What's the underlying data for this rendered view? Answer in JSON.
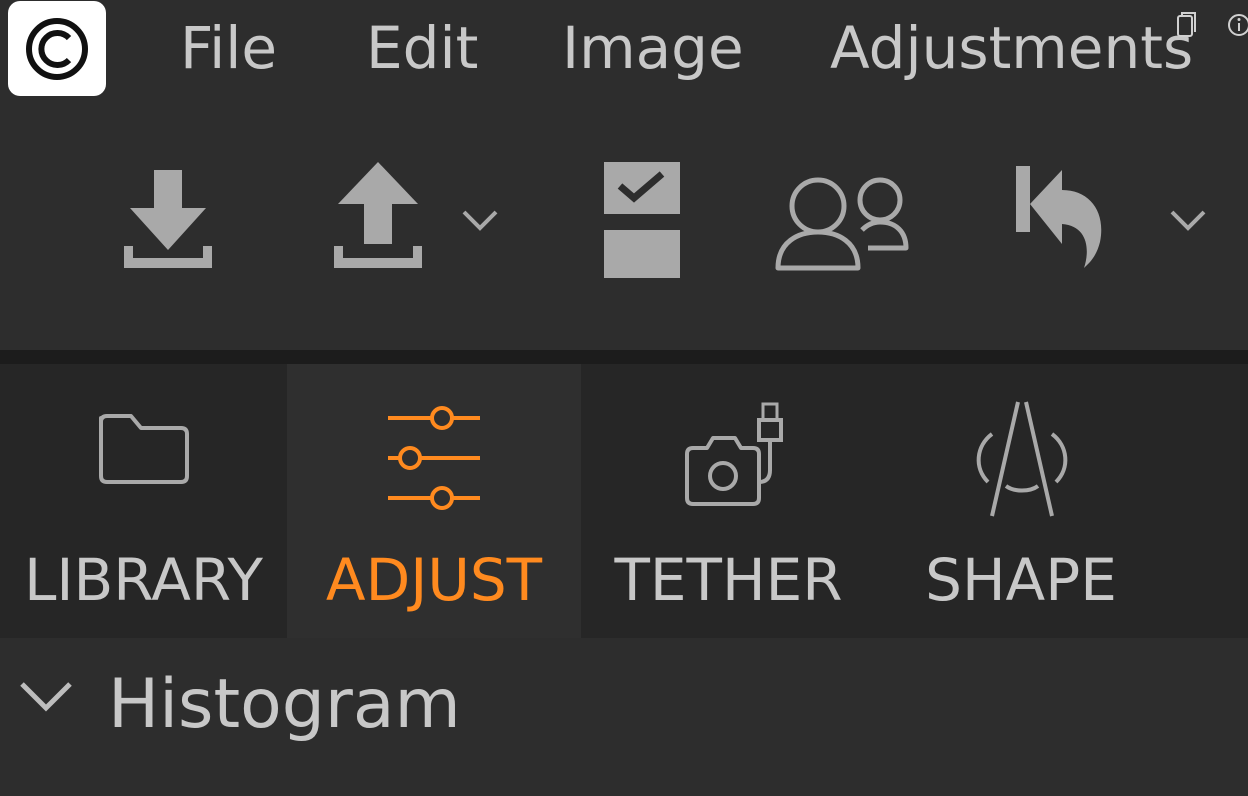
{
  "app": {
    "logo_icon": "app-logo-icon"
  },
  "menu": {
    "items": [
      {
        "label": "File"
      },
      {
        "label": "Edit"
      },
      {
        "label": "Image"
      },
      {
        "label": "Adjustments"
      }
    ]
  },
  "toolbar": {
    "buttons": [
      {
        "icon": "import-icon"
      },
      {
        "icon": "export-icon"
      },
      {
        "icon": "chevron-down-icon"
      },
      {
        "icon": "checklist-icon"
      },
      {
        "icon": "users-icon"
      },
      {
        "icon": "undo-icon"
      },
      {
        "icon": "chevron-down-icon"
      }
    ]
  },
  "modes": {
    "tabs": [
      {
        "label": "LIBRARY",
        "icon": "folder-icon"
      },
      {
        "label": "ADJUST",
        "icon": "sliders-icon",
        "active": true
      },
      {
        "label": "TETHER",
        "icon": "camera-tether-icon"
      },
      {
        "label": "SHAPE",
        "icon": "shape-icon"
      }
    ]
  },
  "panel": {
    "title": "Histogram"
  },
  "colors": {
    "accent": "#ff8a1f",
    "background": "#2d2d2d",
    "tab_bar": "#262626",
    "text": "#c8c8c8"
  }
}
